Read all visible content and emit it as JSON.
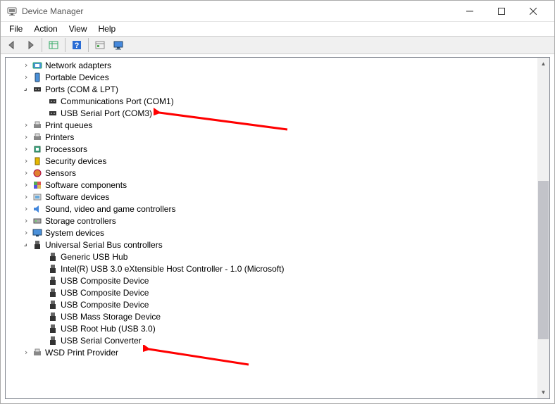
{
  "window": {
    "title": "Device Manager"
  },
  "menu": {
    "file": "File",
    "action": "Action",
    "view": "View",
    "help": "Help"
  },
  "tree": {
    "network_adapters": "Network adapters",
    "portable_devices": "Portable Devices",
    "ports": "Ports (COM & LPT)",
    "com_port": "Communications Port (COM1)",
    "usb_serial_port": "USB Serial Port (COM3)",
    "print_queues": "Print queues",
    "printers": "Printers",
    "processors": "Processors",
    "security_devices": "Security devices",
    "sensors": "Sensors",
    "software_components": "Software components",
    "software_devices": "Software devices",
    "sound": "Sound, video and game controllers",
    "storage_controllers": "Storage controllers",
    "system_devices": "System devices",
    "usb_controllers": "Universal Serial Bus controllers",
    "generic_hub": "Generic USB Hub",
    "intel_xhci": "Intel(R) USB 3.0 eXtensible Host Controller - 1.0 (Microsoft)",
    "usb_composite1": "USB Composite Device",
    "usb_composite2": "USB Composite Device",
    "usb_composite3": "USB Composite Device",
    "usb_mass_storage": "USB Mass Storage Device",
    "usb_root_hub": "USB Root Hub (USB 3.0)",
    "usb_serial_converter": "USB Serial Converter",
    "wsd": "WSD Print Provider"
  }
}
